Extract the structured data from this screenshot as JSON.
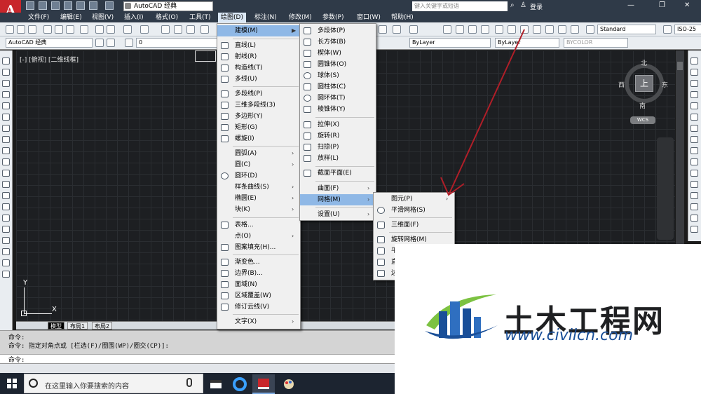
{
  "window": {
    "workspace": "AutoCAD 经典",
    "search_placeholder": "键入关键字或短语",
    "login": "登录"
  },
  "menubar": [
    "文件(F)",
    "编辑(E)",
    "视图(V)",
    "插入(I)",
    "格式(O)",
    "工具(T)",
    "绘图(D)",
    "标注(N)",
    "修改(M)",
    "参数(P)",
    "窗口(W)",
    "帮助(H)"
  ],
  "toolbar": {
    "workspace2": "AutoCAD 经典",
    "layer_value": "0",
    "color": "ByLayer",
    "linetype": "ByLayer",
    "lineweight": "BYCOLOR",
    "text_style": "Standard",
    "dim_style": "ISO-25"
  },
  "viewport": {
    "label": "[-] [俯视] [二维线框]",
    "ucs_x": "X",
    "ucs_y": "Y"
  },
  "viewcube": {
    "top": "上",
    "north": "北",
    "south": "南",
    "east": "东",
    "west": "西",
    "wcs": "WCS"
  },
  "draw_menu": {
    "items": [
      {
        "label": "建模(M)",
        "sub": true
      },
      {
        "label": "直线(L)"
      },
      {
        "label": "射线(R)"
      },
      {
        "label": "构造线(T)"
      },
      {
        "label": "多线(U)"
      },
      {
        "label": "多段线(P)"
      },
      {
        "label": "三维多段线(3)"
      },
      {
        "label": "多边形(Y)"
      },
      {
        "label": "矩形(G)"
      },
      {
        "label": "螺旋(I)"
      },
      {
        "label": "圆弧(A)",
        "sub": true
      },
      {
        "label": "圆(C)",
        "sub": true
      },
      {
        "label": "圆环(D)"
      },
      {
        "label": "样条曲线(S)",
        "sub": true
      },
      {
        "label": "椭圆(E)",
        "sub": true
      },
      {
        "label": "块(K)",
        "sub": true
      },
      {
        "label": "表格..."
      },
      {
        "label": "点(O)",
        "sub": true
      },
      {
        "label": "图案填充(H)..."
      },
      {
        "label": "渐变色..."
      },
      {
        "label": "边界(B)..."
      },
      {
        "label": "面域(N)"
      },
      {
        "label": "区域覆盖(W)"
      },
      {
        "label": "修订云线(V)"
      },
      {
        "label": "文字(X)",
        "sub": true
      }
    ]
  },
  "modeling_menu": {
    "items": [
      {
        "label": "多段体(P)"
      },
      {
        "label": "长方体(B)"
      },
      {
        "label": "楔体(W)"
      },
      {
        "label": "圆锥体(O)"
      },
      {
        "label": "球体(S)"
      },
      {
        "label": "圆柱体(C)"
      },
      {
        "label": "圆环体(T)"
      },
      {
        "label": "棱锥体(Y)"
      },
      {
        "label": "拉伸(X)"
      },
      {
        "label": "旋转(R)"
      },
      {
        "label": "扫掠(P)"
      },
      {
        "label": "放样(L)"
      },
      {
        "label": "截面平面(E)"
      },
      {
        "label": "曲面(F)",
        "sub": true
      },
      {
        "label": "网格(M)",
        "sub": true
      },
      {
        "label": "设置(U)",
        "sub": true
      }
    ]
  },
  "mesh_menu": {
    "items": [
      {
        "label": "图元(P)",
        "sub": true
      },
      {
        "label": "平滑网格(S)"
      },
      {
        "label": "三维面(F)"
      },
      {
        "label": "旋转网格(M)"
      },
      {
        "label": "平"
      },
      {
        "label": "直"
      },
      {
        "label": "边"
      }
    ]
  },
  "tabs": [
    "模型",
    "布局1",
    "布局2"
  ],
  "command": {
    "line1": "命令:",
    "line2": "命令: 指定对角点或 [栏选(F)/圈围(WP)/圈交(CP)]:",
    "prompt": "命令:"
  },
  "taskbar": {
    "search_text": "在这里输入你要搜索的内容"
  },
  "watermark": {
    "title": "土木工程网",
    "url": "www.civilcn.com"
  },
  "colors": {
    "accent_red": "#c8262b",
    "highlight": "#8fb8e6",
    "arrow": "#b01e28",
    "brand_blue": "#1a4f98",
    "brand_green": "#7cc242"
  }
}
